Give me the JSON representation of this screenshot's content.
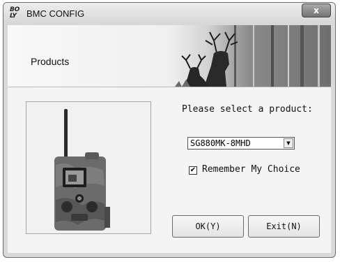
{
  "window": {
    "title": "BMC CONFIG",
    "icon_text": "B O\nLY",
    "close_label": "x"
  },
  "banner": {
    "title": "Products"
  },
  "form": {
    "prompt": "Please select a product:",
    "product_select": {
      "value": "SG880MK-8MHD"
    },
    "remember": {
      "label": "Remember My Choice",
      "checked": true,
      "check_glyph": "✔"
    }
  },
  "buttons": {
    "ok": "OK(Y)",
    "exit": "Exit(N)"
  },
  "colors": {
    "frame": "#d9d9d9",
    "client": "#f4f4f4"
  }
}
